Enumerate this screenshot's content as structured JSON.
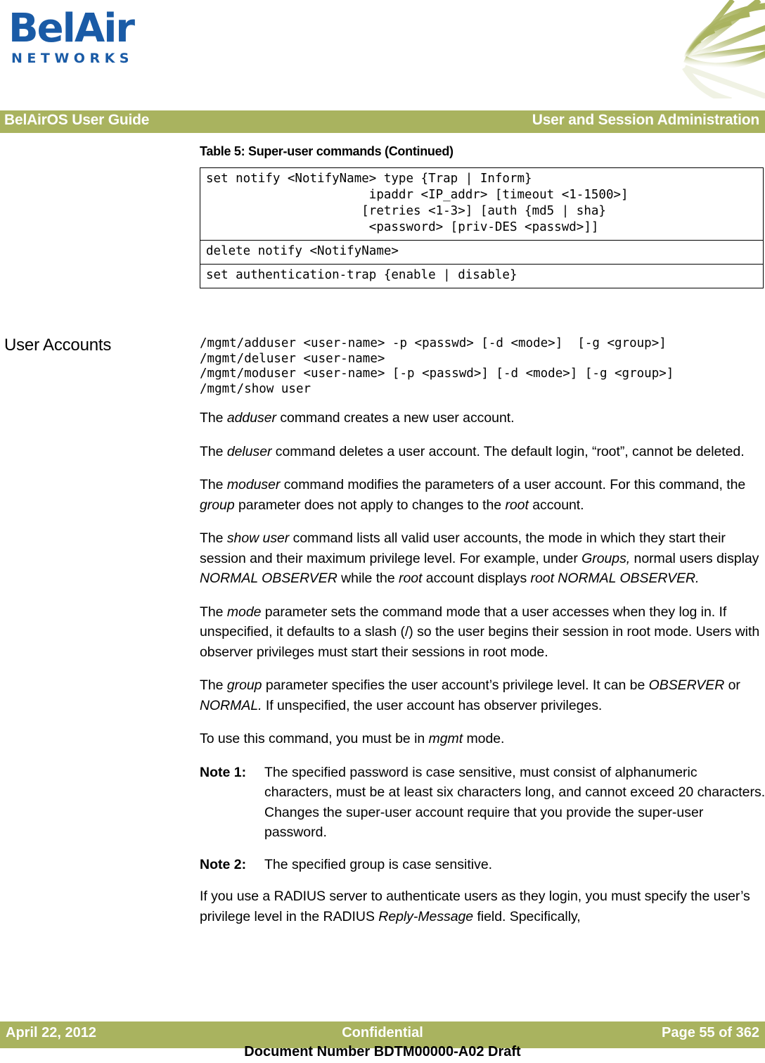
{
  "brand": {
    "logo_word": "BelAir",
    "logo_subtitle": "NETWORKS",
    "logo_color": "#1a5ba6",
    "accent_color": "#a9b35f"
  },
  "header": {
    "left_title": "BelAirOS User Guide",
    "right_title": "User and Session Administration"
  },
  "table": {
    "caption": "Table 5: Super-user commands  (Continued)",
    "rows": [
      "set notify <NotifyName> type {Trap | Inform}\n                      ipaddr <IP_addr> [timeout <1-1500>]\n                     [retries <1-3>] [auth {md5 | sha}\n                      <password> [priv-DES <passwd>]]",
      "delete notify <NotifyName>",
      "set authentication-trap {enable | disable}"
    ]
  },
  "section": {
    "heading": "User Accounts",
    "command_block": "/mgmt/adduser <user-name> -p <passwd> [-d <mode>]  [-g <group>]\n/mgmt/deluser <user-name>\n/mgmt/moduser <user-name> [-p <passwd>] [-d <mode>] [-g <group>]\n/mgmt/show user",
    "paragraphs": [
      {
        "id": "p-adduser",
        "parts": [
          {
            "t": "The ",
            "i": false
          },
          {
            "t": "adduser",
            "i": true
          },
          {
            "t": " command creates a new user account.",
            "i": false
          }
        ]
      },
      {
        "id": "p-deluser",
        "parts": [
          {
            "t": "The ",
            "i": false
          },
          {
            "t": "deluser",
            "i": true
          },
          {
            "t": " command deletes a user account. The default login, “root”, cannot be deleted.",
            "i": false
          }
        ]
      },
      {
        "id": "p-moduser",
        "parts": [
          {
            "t": "The ",
            "i": false
          },
          {
            "t": "moduser",
            "i": true
          },
          {
            "t": " command modifies the parameters of a user account. For this command, the ",
            "i": false
          },
          {
            "t": "group",
            "i": true
          },
          {
            "t": " parameter does not apply to changes to the ",
            "i": false
          },
          {
            "t": "root",
            "i": true
          },
          {
            "t": " account.",
            "i": false
          }
        ]
      },
      {
        "id": "p-showuser",
        "parts": [
          {
            "t": "The ",
            "i": false
          },
          {
            "t": "show user",
            "i": true
          },
          {
            "t": " command lists all valid user accounts, the mode in which they start their session and their maximum privilege level. For example, under ",
            "i": false
          },
          {
            "t": "Groups,",
            "i": true
          },
          {
            "t": " normal users display ",
            "i": false
          },
          {
            "t": "NORMAL OBSERVER",
            "i": true
          },
          {
            "t": " while the ",
            "i": false
          },
          {
            "t": "root",
            "i": true
          },
          {
            "t": " account displays ",
            "i": false
          },
          {
            "t": "root NORMAL OBSERVER.",
            "i": true
          }
        ]
      },
      {
        "id": "p-mode",
        "parts": [
          {
            "t": "The ",
            "i": false
          },
          {
            "t": "mode",
            "i": true
          },
          {
            "t": " parameter sets the command mode that a user accesses when they log in. If unspecified, it defaults to a slash (/) so the user begins their session in root mode. Users with observer privileges must start their sessions in root mode.",
            "i": false
          }
        ]
      },
      {
        "id": "p-group",
        "parts": [
          {
            "t": "The ",
            "i": false
          },
          {
            "t": "group",
            "i": true
          },
          {
            "t": " parameter specifies the user account’s privilege level. It can be ",
            "i": false
          },
          {
            "t": "OBSERVER",
            "i": true
          },
          {
            "t": " or ",
            "i": false
          },
          {
            "t": "NORMAL.",
            "i": true
          },
          {
            "t": " If unspecified, the user account has observer privileges.",
            "i": false
          }
        ]
      },
      {
        "id": "p-mgmt-mode",
        "parts": [
          {
            "t": "To use this command, you must be in ",
            "i": false
          },
          {
            "t": "mgmt",
            "i": true
          },
          {
            "t": " mode.",
            "i": false
          }
        ]
      }
    ],
    "notes": [
      {
        "label": "Note 1:",
        "parts": [
          {
            "t": "The specified password is case sensitive, must consist of alphanumeric characters, must be at least six characters long, and cannot exceed 20 characters. Changes the super-user account require that you provide the super-user password.",
            "i": false
          }
        ]
      },
      {
        "label": "Note 2:",
        "parts": [
          {
            "t": "The specified group is case sensitive.",
            "i": false
          }
        ]
      }
    ],
    "closing": {
      "id": "p-radius",
      "parts": [
        {
          "t": "If you use a RADIUS server to authenticate users as they login, you must specify the user’s privilege level in the RADIUS ",
          "i": false
        },
        {
          "t": "Reply-Message",
          "i": true
        },
        {
          "t": " field. Specifically,",
          "i": false
        }
      ]
    }
  },
  "footer": {
    "date": "April 22, 2012",
    "classification": "Confidential",
    "page": "Page 55 of 362",
    "document_number": "Document Number BDTM00000-A02 Draft"
  }
}
